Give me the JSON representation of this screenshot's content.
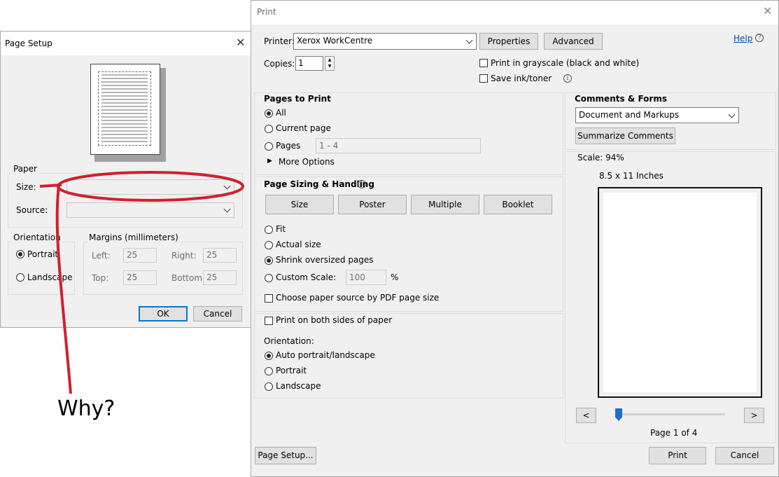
{
  "annotation": {
    "text": "Why?",
    "color": "#d0202e"
  },
  "page_setup": {
    "title": "Page Setup",
    "paper_group": "Paper",
    "size_label": "Size:",
    "source_label": "Source:",
    "orientation_group": "Orientation",
    "portrait": "Portrait",
    "landscape": "Landscape",
    "margins_group": "Margins (millimeters)",
    "left_label": "Left:",
    "right_label": "Right:",
    "top_label": "Top:",
    "bottom_label": "Bottom:",
    "left_value": "25",
    "right_value": "25",
    "top_value": "25",
    "bottom_value": "25",
    "ok": "OK",
    "cancel": "Cancel"
  },
  "print": {
    "title": "Print",
    "printer_label": "Printer:",
    "printer_value": "Xerox WorkCentre",
    "properties": "Properties",
    "advanced": "Advanced",
    "help": "Help",
    "copies_label": "Copies:",
    "copies_value": "1",
    "grayscale": "Print in grayscale (black and white)",
    "save_ink": "Save ink/toner",
    "pages_to_print": "Pages to Print",
    "all": "All",
    "current_page": "Current page",
    "pages": "Pages",
    "pages_range": "1 - 4",
    "more_options": "More Options",
    "sizing_title": "Page Sizing & Handling",
    "tab_size": "Size",
    "tab_poster": "Poster",
    "tab_multiple": "Multiple",
    "tab_booklet": "Booklet",
    "fit": "Fit",
    "actual_size": "Actual size",
    "shrink": "Shrink oversized pages",
    "custom_scale": "Custom Scale:",
    "custom_scale_value": "100",
    "percent": "%",
    "choose_paper": "Choose paper source by PDF page size",
    "both_sides": "Print on both sides of paper",
    "orientation_label": "Orientation:",
    "auto_orient": "Auto portrait/landscape",
    "portrait": "Portrait",
    "landscape": "Landscape",
    "comments_title": "Comments & Forms",
    "comments_value": "Document and Markups",
    "summarize": "Summarize Comments",
    "scale_text": "Scale:  94%",
    "paper_size_text": "8.5 x 11 Inches",
    "prev": "<",
    "next": ">",
    "page_counter": "Page 1 of 4",
    "page_setup_btn": "Page Setup...",
    "print_btn": "Print",
    "cancel_btn": "Cancel",
    "preview_progress": 0.0
  }
}
